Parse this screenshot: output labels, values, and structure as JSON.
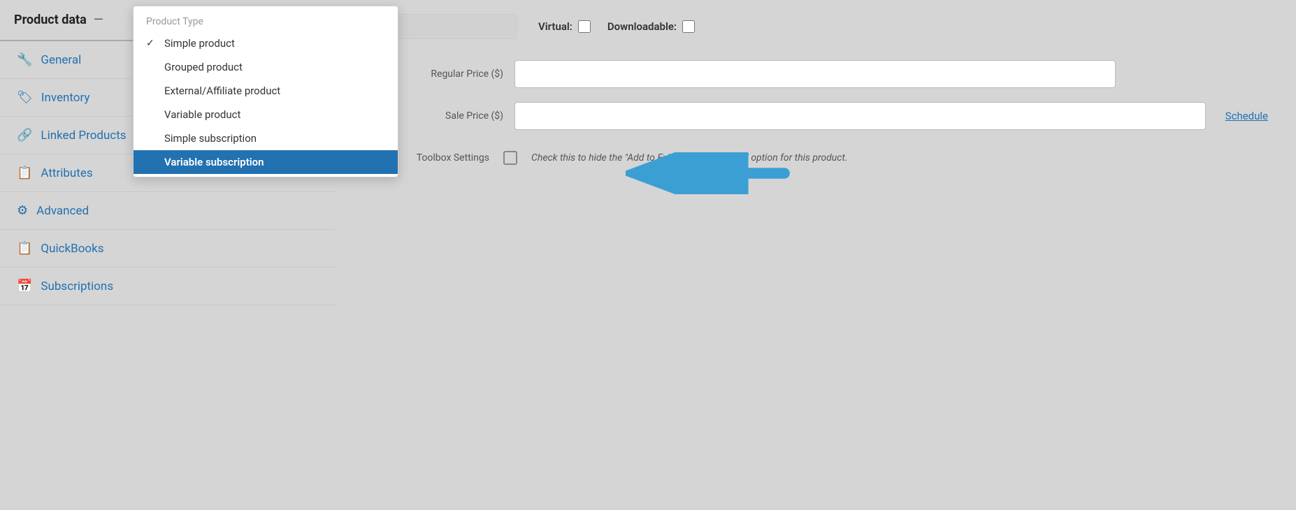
{
  "header": {
    "product_data_label": "Product data",
    "dash": "—"
  },
  "sidebar": {
    "items": [
      {
        "id": "general",
        "label": "General",
        "icon": "wrench"
      },
      {
        "id": "inventory",
        "label": "Inventory",
        "icon": "tag"
      },
      {
        "id": "linked-products",
        "label": "Linked Products",
        "icon": "link"
      },
      {
        "id": "attributes",
        "label": "Attributes",
        "icon": "table"
      },
      {
        "id": "advanced",
        "label": "Advanced",
        "icon": "gear"
      },
      {
        "id": "quickbooks",
        "label": "QuickBooks",
        "icon": "table"
      },
      {
        "id": "subscriptions",
        "label": "Subscriptions",
        "icon": "calendar"
      }
    ]
  },
  "dropdown": {
    "header": "Product Type",
    "items": [
      {
        "id": "simple",
        "label": "Simple product",
        "checked": true,
        "selected": false
      },
      {
        "id": "grouped",
        "label": "Grouped product",
        "checked": false,
        "selected": false
      },
      {
        "id": "external",
        "label": "External/Affiliate product",
        "checked": false,
        "selected": false
      },
      {
        "id": "variable",
        "label": "Variable product",
        "checked": false,
        "selected": false
      },
      {
        "id": "simple-subscription",
        "label": "Simple subscription",
        "checked": false,
        "selected": false
      },
      {
        "id": "variable-subscription",
        "label": "Variable subscription",
        "checked": false,
        "selected": true
      }
    ]
  },
  "topbar": {
    "virtual_label": "Virtual:",
    "downloadable_label": "Downloadable:"
  },
  "form": {
    "price_label": "Regular Price ($)",
    "sale_price_label": "Sale Price ($)",
    "schedule_link": "Schedule"
  },
  "toolbox": {
    "label": "Toolbox Settings",
    "description": "Check this to hide the \"Add to Existing Subscription\" option for this product."
  },
  "icons": {
    "wrench": "🔧",
    "tag": "🏷",
    "link": "🔗",
    "table": "📋",
    "gear": "⚙",
    "calendar": "📅",
    "check": "✓"
  }
}
